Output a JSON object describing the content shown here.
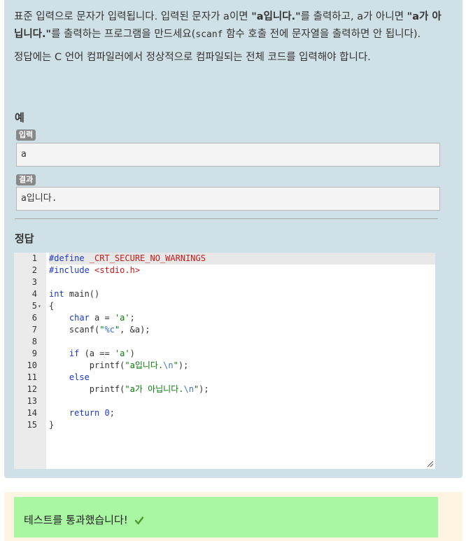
{
  "question": {
    "p1_a": "표준 입력으로 문자가 입력됩니다. 입력된 문자가 a이면 ",
    "p1_b": "\"a입니다.\"",
    "p1_c": "를 출력하고, a가 아니면 ",
    "p1_d": "\"a가 아닙니다.\"",
    "p1_e": "를 출력하는 프로그램을 만드세요(",
    "p1_f": "scanf",
    "p1_g": " 함수 호출 전에 문자열을 출력하면 안 됩니다).",
    "p2": "정답에는 C 언어 컴파일러에서 정상적으로 컴파일되는 전체 코드를 입력해야 합니다."
  },
  "example": {
    "title": "예",
    "input_label": "입력",
    "input_value": "a",
    "result_label": "결과",
    "result_value": "a입니다."
  },
  "answer": {
    "title": "정답",
    "line_numbers": [
      "1",
      "2",
      "3",
      "4",
      "5",
      "6",
      "7",
      "8",
      "9",
      "10",
      "11",
      "12",
      "13",
      "14",
      "15"
    ]
  },
  "result": {
    "message": "테스트를 통과했습니다!"
  },
  "colors": {
    "panel_bg": "#cfe0e6",
    "success_bg": "#a8f5a2",
    "result_panel_bg": "#fdf5e1"
  }
}
